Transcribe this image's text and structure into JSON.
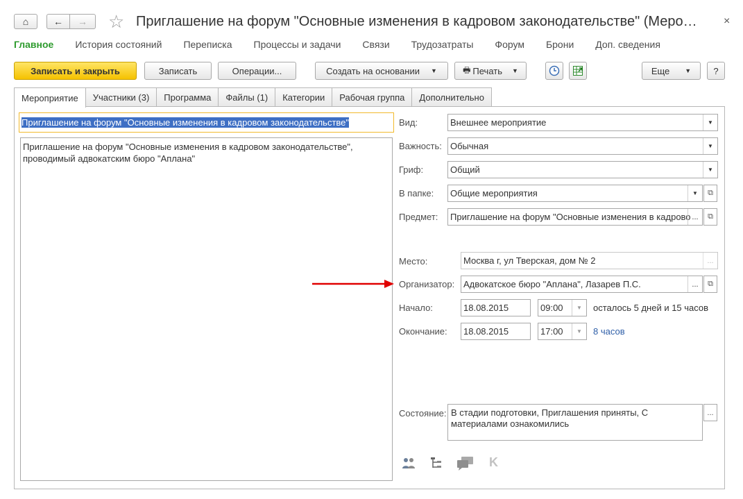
{
  "window": {
    "title": "Приглашение на форум \"Основные изменения в кадровом законодательстве\" (Меро…",
    "close_glyph": "×"
  },
  "nav": {
    "home_glyph": "⌂",
    "back_glyph": "←",
    "forward_glyph": "→",
    "favorite_glyph": "☆"
  },
  "sections": [
    "Главное",
    "История состояний",
    "Переписка",
    "Процессы и задачи",
    "Связи",
    "Трудозатраты",
    "Форум",
    "Брони",
    "Доп. сведения"
  ],
  "toolbar": {
    "save_close": "Записать и закрыть",
    "save": "Записать",
    "operations": "Операции...",
    "create_based": "Создать на основании",
    "print": "Печать",
    "more": "Еще",
    "help": "?"
  },
  "tabs": [
    "Мероприятие",
    "Участники (3)",
    "Программа",
    "Файлы (1)",
    "Категории",
    "Рабочая группа",
    "Дополнительно"
  ],
  "event": {
    "name": "Приглашение на форум \"Основные изменения в кадровом законодательстве\"",
    "description": "Приглашение на форум \"Основные изменения в кадровом законодательстве\", проводимый адвокатским бюро \"Аплана\""
  },
  "fields": {
    "kind_label": "Вид:",
    "kind": "Внешнее мероприятие",
    "importance_label": "Важность:",
    "importance": "Обычная",
    "grif_label": "Гриф:",
    "grif": "Общий",
    "folder_label": "В папке:",
    "folder": "Общие мероприятия",
    "subject_label": "Предмет:",
    "subject": "Приглашение на форум \"Основные изменения в кадрово",
    "place_label": "Место:",
    "place": "Москва г, ул Тверская, дом № 2",
    "organizer_label": "Организатор:",
    "organizer": "Адвокатское бюро \"Аплана\", Лазарев П.С.",
    "start_label": "Начало:",
    "start_date": "18.08.2015",
    "start_time": "09:00",
    "start_remaining": "осталось 5 дней и 15 часов",
    "end_label": "Окончание:",
    "end_date": "18.08.2015",
    "end_time": "17:00",
    "duration": "8 часов",
    "state_label": "Состояние:",
    "state": "В стадии подготовки, Приглашения приняты, С материалами ознакомились"
  },
  "colors": {
    "accent_green": "#2e9b2e",
    "primary_yellow": "#f5c200",
    "arrow_red": "#e00000",
    "link_blue": "#2f5fa8"
  }
}
